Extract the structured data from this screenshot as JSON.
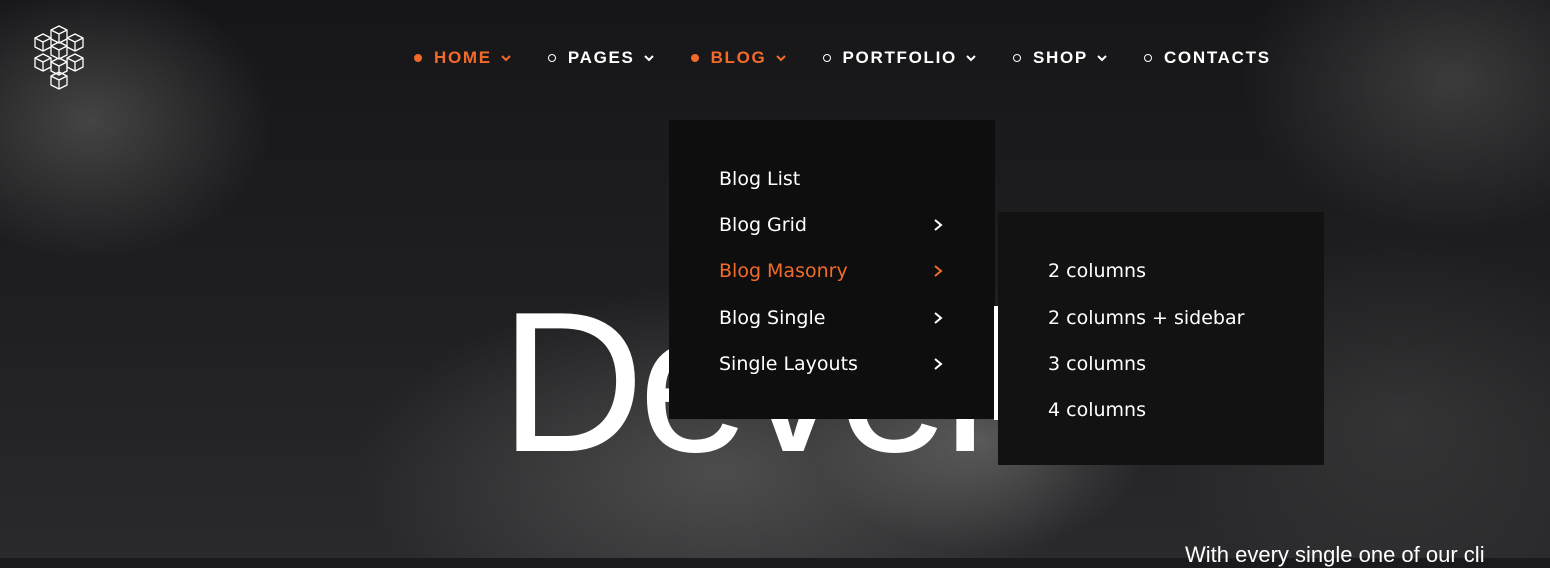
{
  "nav": {
    "items": [
      {
        "label": "HOME",
        "active": true
      },
      {
        "label": "PAGES",
        "active": false
      },
      {
        "label": "BLOG",
        "active": true
      },
      {
        "label": "PORTFOLIO",
        "active": false
      },
      {
        "label": "SHOP",
        "active": false
      },
      {
        "label": "CONTACTS",
        "active": false
      }
    ]
  },
  "blog_menu": {
    "items": [
      {
        "label": "Blog List",
        "has_submenu": false
      },
      {
        "label": "Blog Grid",
        "has_submenu": true
      },
      {
        "label": "Blog Masonry",
        "has_submenu": true,
        "highlighted": true
      },
      {
        "label": "Blog Single",
        "has_submenu": true
      },
      {
        "label": "Single Layouts",
        "has_submenu": true
      }
    ]
  },
  "masonry_submenu": {
    "items": [
      "2 columns",
      "2 columns + sidebar",
      "3 columns",
      "4 columns"
    ]
  },
  "hero": {
    "title": "Devel",
    "subtitle": "With every single one of our cli"
  },
  "colors": {
    "accent": "#f26b2a",
    "text": "#ffffff",
    "menu_bg": "#0e0e0f"
  },
  "icons": {
    "logo": "cube-cluster-logo-icon",
    "nav_indicator": "dot-icon",
    "nav_caret": "chevron-down-icon",
    "submenu_arrow": "chevron-right-icon"
  }
}
